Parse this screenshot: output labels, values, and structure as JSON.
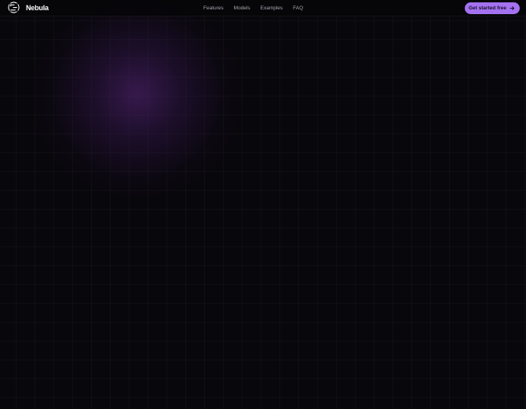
{
  "brand": {
    "name": "Nebula",
    "logo_icon": "nebula-logo-icon"
  },
  "nav": {
    "items": [
      {
        "label": "Features"
      },
      {
        "label": "Models"
      },
      {
        "label": "Examples"
      },
      {
        "label": "FAQ"
      }
    ]
  },
  "cta": {
    "label": "Get started free",
    "icon": "arrow-right-icon"
  },
  "colors": {
    "background": "#08070b",
    "accent": "#a472f0",
    "glow": "#5c2882"
  }
}
